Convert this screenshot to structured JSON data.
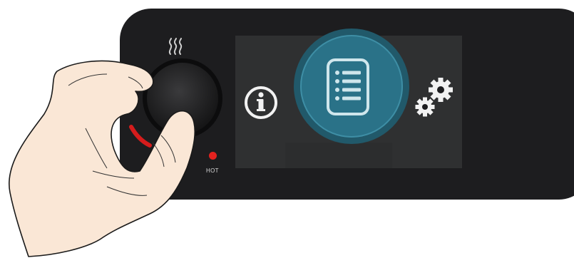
{
  "control_panel": {
    "hot_indicator_label": "HOT",
    "heat_icon": "heat-waves-icon",
    "knob": "rotary-knob",
    "menu": {
      "left_item": "info-icon",
      "selected_item": "list-menu-icon",
      "right_item": "settings-gears-icon"
    }
  },
  "colors": {
    "panel": "#1d1d1f",
    "screen": "#2f3031",
    "selection_highlight": "#2a7288",
    "hot_led": "#e3221f"
  }
}
